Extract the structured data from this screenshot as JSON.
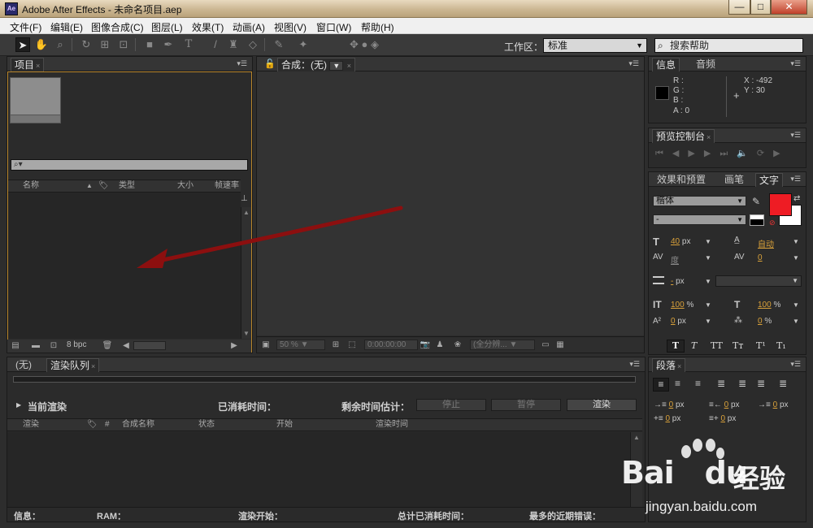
{
  "window": {
    "title": "Adobe After Effects - 未命名项目.aep",
    "app_icon": "Ae",
    "min": "—",
    "max": "□",
    "close": "✕"
  },
  "menu": [
    "文件(F)",
    "编辑(E)",
    "图像合成(C)",
    "图层(L)",
    "效果(T)",
    "动画(A)",
    "视图(V)",
    "窗口(W)",
    "帮助(H)"
  ],
  "toolbar": {
    "workspace_label": "工作区：",
    "workspace_value": "标准",
    "search_placeholder": "搜索帮助"
  },
  "project": {
    "tab": "项目",
    "search_placeholder": "",
    "columns": [
      "名称",
      "类型",
      "大小",
      "帧速率"
    ],
    "bpc": "8 bpc"
  },
  "composition": {
    "tab": "合成：(无)",
    "zoom": "50 %",
    "timecode": "0:00:00:00",
    "resolution": "(全分辨..."
  },
  "info": {
    "tabs": [
      "信息",
      "音频"
    ],
    "r": "R :",
    "g": "G :",
    "b": "B :",
    "a": "A : 0",
    "x": "X : -492",
    "y": "Y : 30"
  },
  "preview": {
    "tab": "预览控制台"
  },
  "character": {
    "tabs": [
      "效果和预置",
      "画笔",
      "文字"
    ],
    "font": "楷体",
    "style": "-",
    "size": "40",
    "size_unit": "px",
    "leading": "自动",
    "kerning": "度",
    "tracking": "0",
    "stroke": "-",
    "stroke_unit": "px",
    "vscale": "100",
    "hscale": "100",
    "pct": "%",
    "baseline": "0",
    "baseline_unit": "px",
    "tsume": "0",
    "colors": {
      "fill": "#ee1c24",
      "stroke": "#ffffff"
    }
  },
  "paragraph": {
    "tab": "段落",
    "values": [
      "0",
      "0",
      "0",
      "0",
      "0"
    ],
    "unit": "px"
  },
  "render_queue": {
    "tabs": [
      "(无)",
      "渲染队列"
    ],
    "current_render": "当前渲染",
    "elapsed": "已消耗时间：",
    "remaining": "剩余时间估计：",
    "stop": "停止",
    "pause": "暂停",
    "render": "渲染",
    "columns": [
      "渲染",
      "#",
      "合成名称",
      "状态",
      "开始",
      "渲染时间"
    ],
    "status": {
      "info": "信息：",
      "ram": "RAM：",
      "render_start": "渲染开始：",
      "total_elapsed": "总计已消耗时间：",
      "recent_error": "最多的近期错误："
    }
  },
  "watermark": {
    "brand": "Bai",
    "brand2": "du",
    "cn": "经验",
    "url": "jingyan.baidu.com"
  }
}
